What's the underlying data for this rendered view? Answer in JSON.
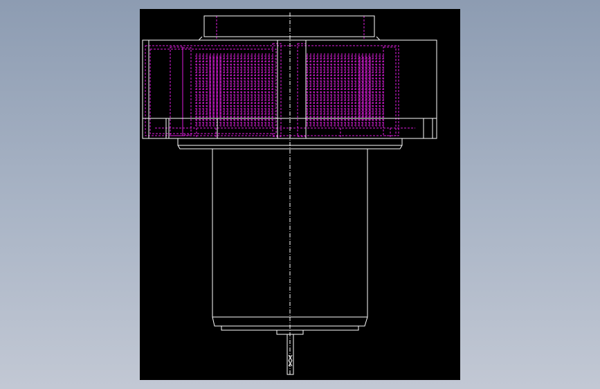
{
  "viewport": {
    "background": "#000000"
  },
  "colors": {
    "outline": "#ffffff",
    "hidden": "#e01ee0",
    "centerline": "#ffffff",
    "page_background": "#9aa7ba"
  },
  "drawing": {
    "view": "front",
    "parts": [
      {
        "name": "top-flange",
        "style": "outline"
      },
      {
        "name": "gear-housing",
        "style": "outline"
      },
      {
        "name": "internal-gears",
        "style": "hidden"
      },
      {
        "name": "motor-body",
        "style": "outline"
      },
      {
        "name": "motor-end-cap",
        "style": "outline"
      },
      {
        "name": "output-shaft",
        "style": "outline"
      },
      {
        "name": "axis-centerline",
        "style": "centerline"
      }
    ]
  }
}
